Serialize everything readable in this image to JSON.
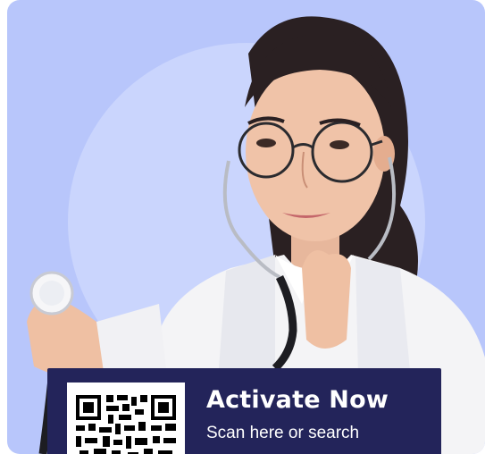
{
  "promo": {
    "title": "Activate Now",
    "subtitle": "Scan here or search",
    "qr_icon": "qr-code-icon",
    "photo_subject": "doctor-with-stethoscope-image"
  },
  "colors": {
    "card_background": "#b8c6fb",
    "circle_highlight": "#cad5fd",
    "banner_background": "#23245a",
    "text": "#ffffff"
  }
}
